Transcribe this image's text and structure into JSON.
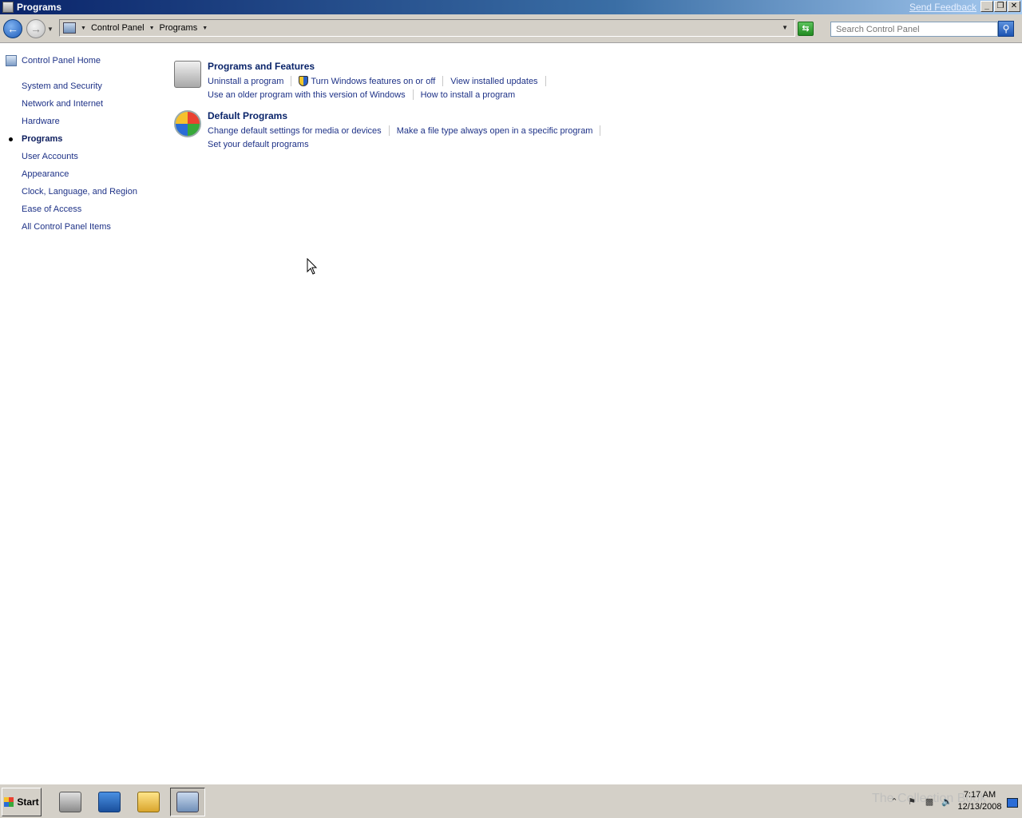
{
  "window": {
    "title": "Programs",
    "feedback_link": "Send Feedback",
    "minimize": "_",
    "restore": "❐",
    "close": "✕"
  },
  "address": {
    "breadcrumbs": [
      "Control Panel",
      "Programs"
    ],
    "search_placeholder": "Search Control Panel"
  },
  "leftnav": {
    "home": "Control Panel Home",
    "items": [
      {
        "label": "System and Security"
      },
      {
        "label": "Network and Internet"
      },
      {
        "label": "Hardware"
      },
      {
        "label": "Programs",
        "current": true
      },
      {
        "label": "User Accounts"
      },
      {
        "label": "Appearance"
      },
      {
        "label": "Clock, Language, and Region"
      },
      {
        "label": "Ease of Access"
      },
      {
        "label": "All Control Panel Items"
      }
    ]
  },
  "categories": [
    {
      "title": "Programs and Features",
      "icon": "programs-features-icon",
      "row1": [
        "Uninstall a program",
        "Turn Windows features on or off",
        "View installed updates"
      ],
      "row2": [
        "Use an older program with this version of Windows",
        "How to install a program"
      ]
    },
    {
      "title": "Default Programs",
      "icon": "default-programs-icon",
      "row1": [
        "Change default settings for media or devices",
        "Make a file type always open in a specific program"
      ],
      "row2": [
        "Set your default programs"
      ]
    }
  ],
  "taskbar": {
    "start": "Start",
    "apps": [
      "server-manager-icon",
      "powershell-icon",
      "explorer-icon",
      "control-panel-icon"
    ],
    "watermark": "The Collection Book",
    "time": "7:17 AM",
    "date": "12/13/2008"
  }
}
